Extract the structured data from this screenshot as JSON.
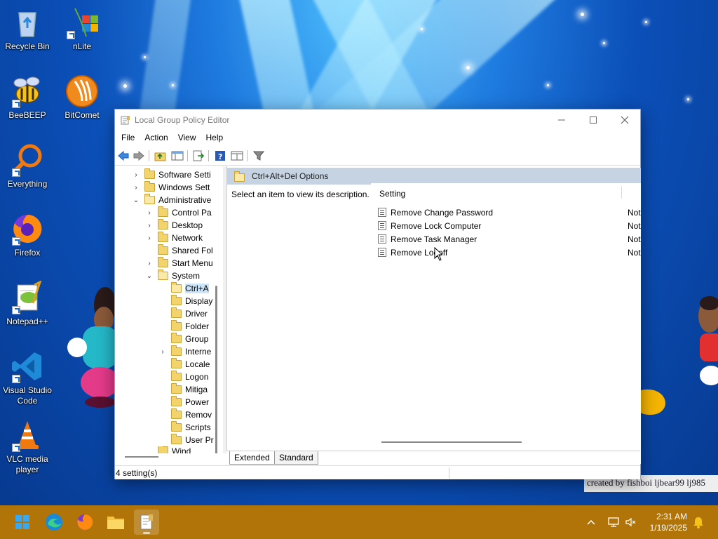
{
  "desktop": {
    "icons": [
      {
        "label": "Recycle Bin"
      },
      {
        "label": "nLite"
      },
      {
        "label": "BeeBEEP"
      },
      {
        "label": "BitComet"
      },
      {
        "label": "Everything"
      },
      {
        "label": "Firefox"
      },
      {
        "label": "Notepad++"
      },
      {
        "label": "Visual Studio Code"
      },
      {
        "label": "VLC media player"
      }
    ],
    "credit_text": "created by fishboi ljbear99 lj985"
  },
  "window": {
    "title": "Local Group Policy Editor",
    "menu": [
      "File",
      "Action",
      "View",
      "Help"
    ],
    "tree": [
      {
        "label": "Software Setti"
      },
      {
        "label": "Windows Sett"
      },
      {
        "label": "Administrative"
      },
      {
        "label": "Control Pa"
      },
      {
        "label": "Desktop"
      },
      {
        "label": "Network"
      },
      {
        "label": "Shared Fol"
      },
      {
        "label": "Start Menu"
      },
      {
        "label": "System"
      },
      {
        "label": "Ctrl+A"
      },
      {
        "label": "Display"
      },
      {
        "label": "Driver"
      },
      {
        "label": "Folder"
      },
      {
        "label": "Group"
      },
      {
        "label": "Interne"
      },
      {
        "label": "Locale"
      },
      {
        "label": "Logon"
      },
      {
        "label": "Mitiga"
      },
      {
        "label": "Power"
      },
      {
        "label": "Remov"
      },
      {
        "label": "Scripts"
      },
      {
        "label": "User Pr"
      },
      {
        "label": "Wind"
      }
    ],
    "section_title": "Ctrl+Alt+Del Options",
    "description": "Select an item to view its description.",
    "column_setting": "Setting",
    "settings": [
      {
        "name": "Remove Change Password",
        "state": "Not"
      },
      {
        "name": "Remove Lock Computer",
        "state": "Not"
      },
      {
        "name": "Remove Task Manager",
        "state": "Not"
      },
      {
        "name": "Remove Logoff",
        "state": "Not"
      }
    ],
    "tabs": [
      "Extended",
      "Standard"
    ],
    "status": "4 setting(s)"
  },
  "taskbar": {
    "time": "2:31 AM",
    "date": "1/19/2025"
  },
  "colors": {
    "taskbar": "#b07408",
    "section_header": "#c5d3e3",
    "selection": "#cce4f7"
  }
}
